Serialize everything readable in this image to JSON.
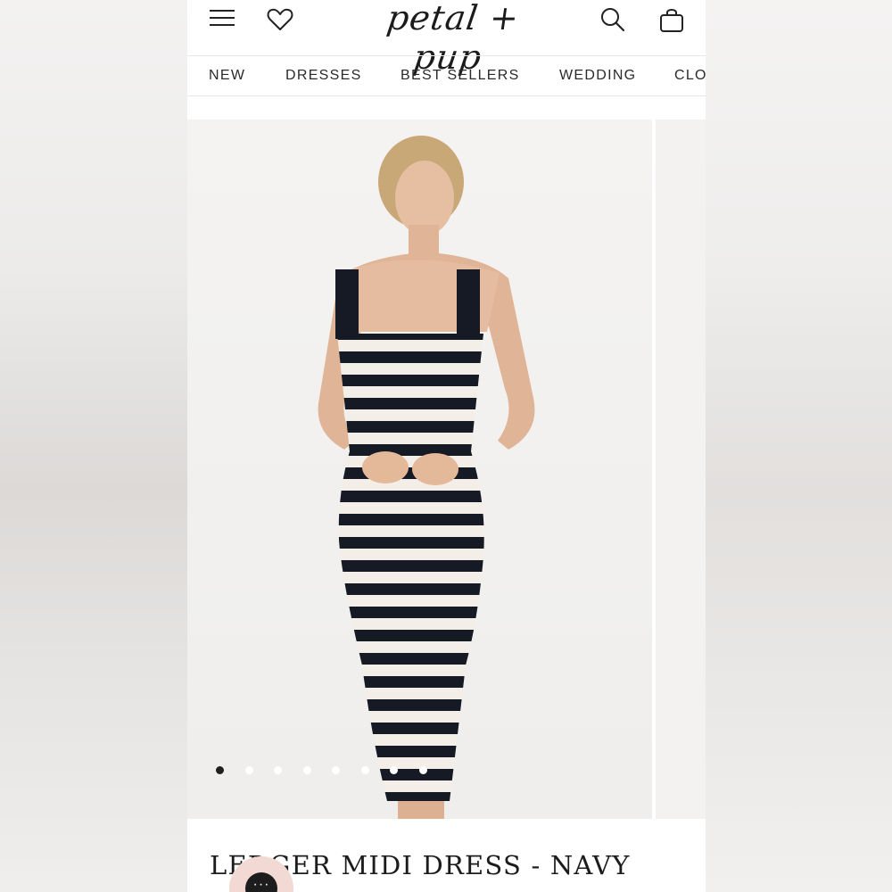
{
  "header": {
    "logo_text": "petal + pup",
    "icons": [
      "menu-icon",
      "heart-icon",
      "search-icon",
      "bag-icon"
    ]
  },
  "nav": {
    "items": [
      "NEW",
      "DRESSES",
      "BEST SELLERS",
      "WEDDING",
      "CLO"
    ]
  },
  "gallery": {
    "image_alt": "Model wearing black and white striped ribbed knit midi dress with square neckline",
    "slide_count": 8,
    "active_slide": 1
  },
  "product": {
    "title": "LEDGER MIDI DRESS - NAVY"
  },
  "chat": {
    "label": "···"
  },
  "colors": {
    "accent_chat": "#f3d9d3",
    "text": "#1c1c1c"
  }
}
